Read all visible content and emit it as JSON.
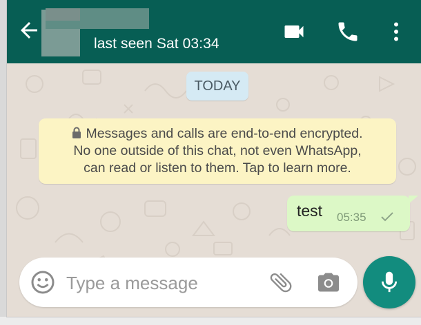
{
  "header": {
    "status": "last seen Sat 03:34",
    "icons": [
      "back-arrow-icon",
      "video-call-icon",
      "phone-icon",
      "more-vert-icon"
    ],
    "color": "#075e54"
  },
  "chat": {
    "date_chip": "TODAY",
    "notice_lines": [
      "Messages and calls are end-to-end encrypted.",
      "No one outside of this chat, not even WhatsApp,",
      "can read or listen to them. Tap to learn more."
    ],
    "messages": [
      {
        "text": "test",
        "time": "05:35",
        "status": "sent-check-icon"
      }
    ]
  },
  "input": {
    "placeholder": "Type a message",
    "icons": [
      "emoji-icon",
      "attach-icon",
      "camera-icon",
      "mic-icon"
    ]
  },
  "colors": {
    "accent": "#128c7e",
    "bubble": "#dcf8c6",
    "notice": "#fcf4c4",
    "date_chip": "#d5eaf4",
    "wallpaper": "#e5ddd5"
  }
}
